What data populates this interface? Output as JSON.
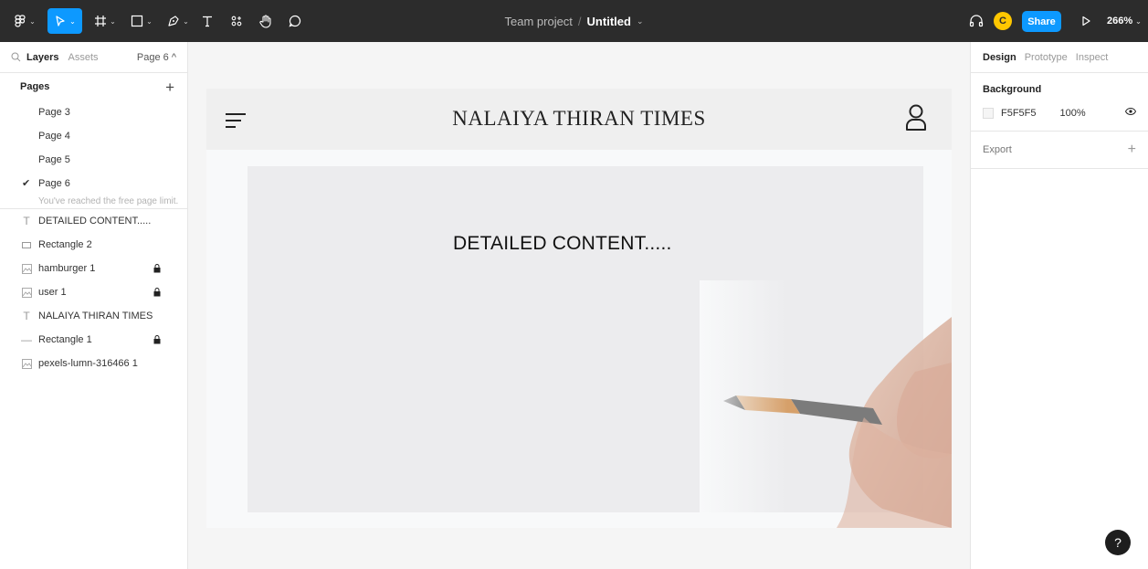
{
  "toolbar": {
    "file": {
      "project": "Team project",
      "separator": "/",
      "name": "Untitled"
    },
    "avatar_initial": "C",
    "share_label": "Share",
    "zoom": "266%"
  },
  "left_panel": {
    "tabs": {
      "layers": "Layers",
      "assets": "Assets"
    },
    "current_page": "Page 6 ^",
    "pages_label": "Pages",
    "pages": [
      "Page 3",
      "Page 4",
      "Page 5",
      "Page 6"
    ],
    "selected_page": "Page 6",
    "page_limit_note": "You've reached the free page limit.",
    "layers": [
      {
        "name": "DETAILED CONTENT.....",
        "icon": "text-icon",
        "locked": false
      },
      {
        "name": "Rectangle 2",
        "icon": "rectangle-icon",
        "locked": false
      },
      {
        "name": "hamburger 1",
        "icon": "image-icon",
        "locked": true
      },
      {
        "name": "user 1",
        "icon": "image-icon",
        "locked": true
      },
      {
        "name": "NALAIYA THIRAN TIMES",
        "icon": "text-icon",
        "locked": false
      },
      {
        "name": "Rectangle 1",
        "icon": "line-icon",
        "locked": true
      },
      {
        "name": "pexels-lumn-316466 1",
        "icon": "image-icon",
        "locked": false
      }
    ]
  },
  "right_panel": {
    "tabs": {
      "design": "Design",
      "prototype": "Prototype",
      "inspect": "Inspect"
    },
    "background_label": "Background",
    "background_hex": "F5F5F5",
    "background_opacity": "100%",
    "export_label": "Export",
    "help_label": "?"
  },
  "canvas": {
    "brand_title": "NALAIYA THIRAN TIMES",
    "content_text": "DETAILED CONTENT....."
  },
  "colors": {
    "toolbar": "#2c2c2c",
    "accent": "#0d99ff",
    "avatar": "#ffc700",
    "canvas_bg": "#f5f5f5"
  }
}
